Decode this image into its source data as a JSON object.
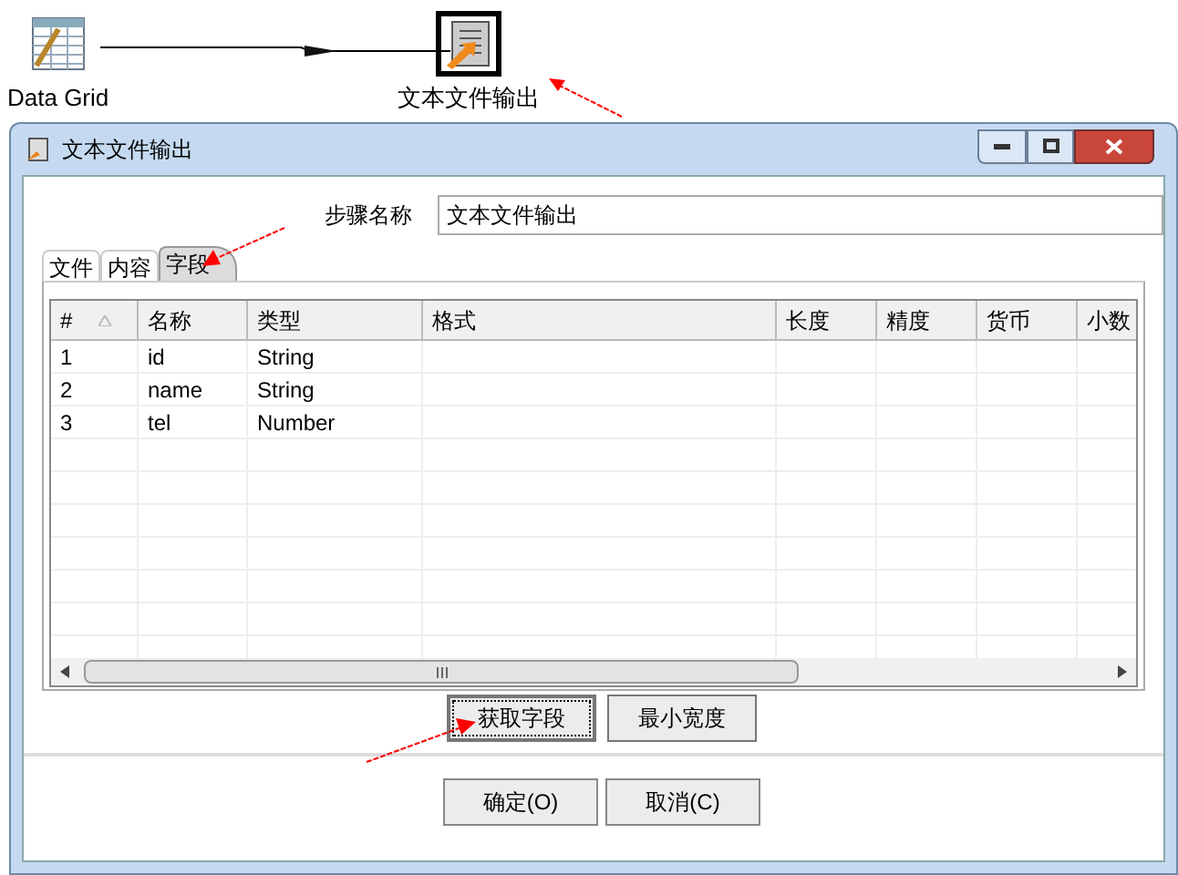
{
  "canvas": {
    "nodes": [
      {
        "kind": "grid",
        "label": "Data Grid"
      },
      {
        "kind": "file_output",
        "label": "文本文件输出",
        "selected": true
      }
    ]
  },
  "window": {
    "title": "文本文件输出"
  },
  "step_name": {
    "label": "步骤名称",
    "value": "文本文件输出"
  },
  "tabs": [
    {
      "label": "文件",
      "selected": false
    },
    {
      "label": "内容",
      "selected": false
    },
    {
      "label": "字段",
      "selected": true
    }
  ],
  "table": {
    "columns": [
      "#",
      "名称",
      "类型",
      "格式",
      "长度",
      "精度",
      "货币",
      "小数"
    ],
    "rows": [
      [
        "1",
        "id",
        "String"
      ],
      [
        "2",
        "name",
        "String"
      ],
      [
        "3",
        "tel",
        "Number"
      ]
    ]
  },
  "field_buttons": [
    {
      "label": "获取字段",
      "focused": true
    },
    {
      "label": "最小宽度",
      "focused": false
    }
  ],
  "buttons": [
    "确定(O)",
    "取消(C)"
  ]
}
